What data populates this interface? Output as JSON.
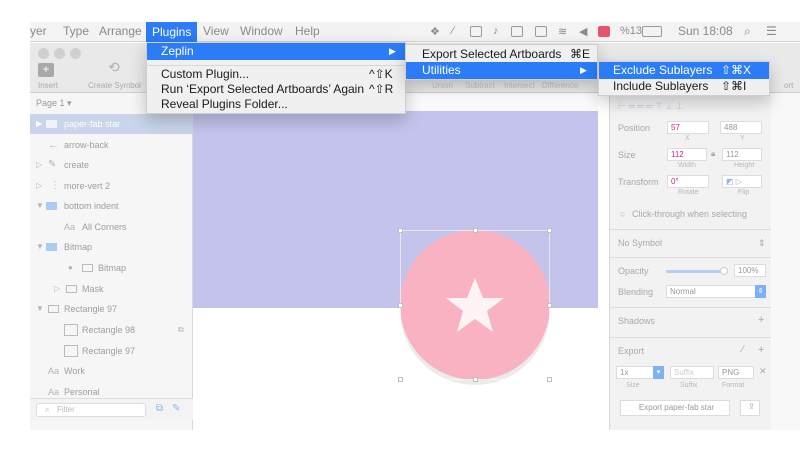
{
  "menubar": {
    "items": [
      "yer",
      "Type",
      "Arrange",
      "Plugins",
      "View",
      "Window",
      "Help"
    ],
    "battery": "%13",
    "clock": "Sun 18:08"
  },
  "toolbar": {
    "insert_label": "Insert",
    "create_symbol_label": "Create Symbol",
    "right_label": "ort"
  },
  "plugins_menu": {
    "zeplin": "Zeplin",
    "custom_plugin": "Custom Plugin...",
    "custom_plugin_shortcut": "^⇧K",
    "run_again": "Run ‘Export Selected Artboards’ Again",
    "run_again_shortcut": "^⇧R",
    "reveal_folder": "Reveal Plugins Folder..."
  },
  "zeplin_menu": {
    "export_selected": "Export Selected Artboards",
    "export_selected_shortcut": "⌘E",
    "utilities": "Utilities"
  },
  "utilities_menu": {
    "exclude_sublayers": "Exclude Sublayers",
    "exclude_sublayers_shortcut": "⇧⌘X",
    "include_sublayers": "Include Sublayers",
    "include_sublayers_shortcut": "⇧⌘I"
  },
  "layers": {
    "page": "Page 1",
    "items": [
      "paper-fab star",
      "arrow-back",
      "create",
      "more-vert 2",
      "bottom indent",
      "All Corners",
      "Bitmap",
      "Bitmap",
      "Mask",
      "Rectangle 97",
      "Rectangle 98",
      "Rectangle 97",
      "Work",
      "Personal"
    ],
    "filter_placeholder": "Filter"
  },
  "toolbar_hidden_labels": {
    "union": "Union",
    "subtract": "Subtract",
    "intersect": "Intersect",
    "difference": "Difference"
  },
  "inspector": {
    "position_label": "Position",
    "x_value": "57",
    "y_value": "488",
    "x_sub": "X",
    "y_sub": "Y",
    "size_label": "Size",
    "width_value": "112",
    "height_value": "112",
    "width_sub": "Width",
    "height_sub": "Height",
    "transform_label": "Transform",
    "rotate_value": "0°",
    "rotate_sub": "Rotate",
    "flip_sub": "Flip",
    "click_through": "Click-through when selecting",
    "symbol": "No Symbol",
    "opacity_label": "Opacity",
    "opacity_value": "100%",
    "blending_label": "Blending",
    "blending_value": "Normal",
    "shadows_label": "Shadows",
    "export_label": "Export",
    "export_scale": "1x",
    "export_suffix_placeholder": "Suffix",
    "export_format": "PNG",
    "size_sub": "Size",
    "suffix_sub": "Suffix",
    "format_sub": "Format",
    "export_button": "Export paper-fab star"
  },
  "colors": {
    "accent": "#2b7cf6",
    "artboard": "#c3c3ec",
    "fab": "#f8b2c2"
  }
}
